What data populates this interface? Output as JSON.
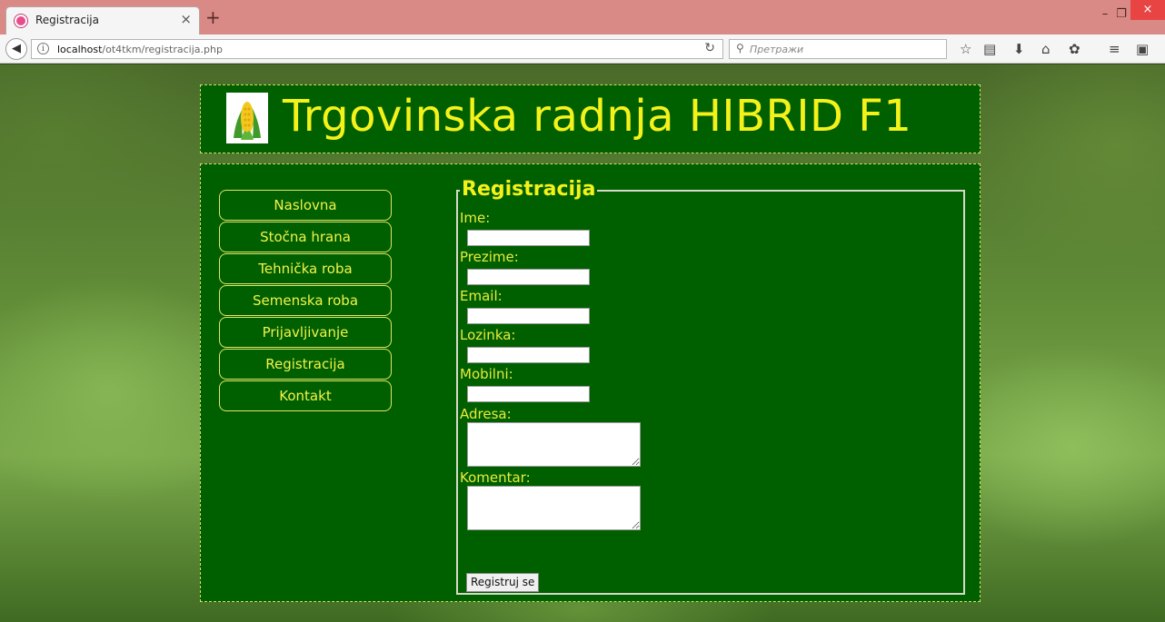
{
  "browser": {
    "tab_title": "Registracija",
    "tab_close": "×",
    "new_tab": "+",
    "url_host": "localhost",
    "url_path": "/ot4tkm/registracija.php",
    "search_placeholder": "Претражи",
    "minimize": "–",
    "restore": "❐",
    "close": "×"
  },
  "site": {
    "title": "Trgovinska radnja HIBRID F1",
    "accent_color": "#f5f21a",
    "panel_color": "#006000"
  },
  "nav": {
    "items": [
      {
        "label": "Naslovna"
      },
      {
        "label": "Stočna hrana"
      },
      {
        "label": "Tehnička roba"
      },
      {
        "label": "Semenska roba"
      },
      {
        "label": "Prijavljivanje"
      },
      {
        "label": "Registracija"
      },
      {
        "label": "Kontakt"
      }
    ]
  },
  "form": {
    "legend": "Registracija",
    "fields": {
      "ime": {
        "label": "Ime:",
        "value": ""
      },
      "prezime": {
        "label": "Prezime:",
        "value": ""
      },
      "email": {
        "label": "Email:",
        "value": ""
      },
      "lozinka": {
        "label": "Lozinka:",
        "value": ""
      },
      "mobilni": {
        "label": "Mobilni:",
        "value": ""
      },
      "adresa": {
        "label": "Adresa:",
        "value": ""
      },
      "komentar": {
        "label": "Komentar:",
        "value": ""
      }
    },
    "submit_label": "Registruj se"
  }
}
